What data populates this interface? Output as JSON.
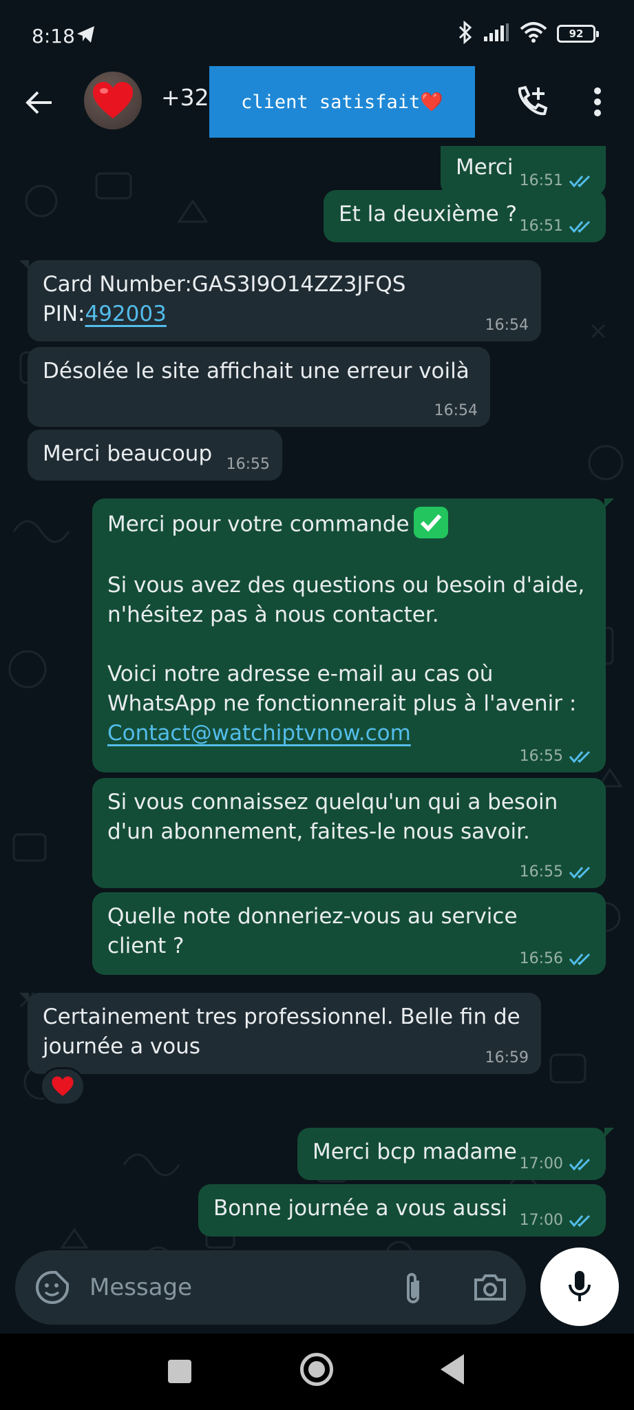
{
  "status_bar": {
    "time": "8:18",
    "battery": "92"
  },
  "header": {
    "contact_name": "+32",
    "overlay_label": "client satisfait❤️",
    "avatar_emoji": "❤️"
  },
  "messages": [
    {
      "direction": "out",
      "text": "Merci",
      "time": "16:51",
      "status": "read"
    },
    {
      "direction": "out",
      "text": "Et la deuxième ?",
      "time": "16:51",
      "status": "read"
    },
    {
      "direction": "in",
      "text_line1": "Card Number:GAS3I9O14ZZ3JFQS",
      "pin_label": "PIN:",
      "pin_value": "492003",
      "time": "16:54"
    },
    {
      "direction": "in",
      "text": "Désolée le site affichait une erreur voilà",
      "time": "16:54"
    },
    {
      "direction": "in",
      "text": "Merci beaucoup",
      "time": "16:55"
    },
    {
      "direction": "out",
      "text_line1": "Merci pour votre commande",
      "paragraph2": "Si vous avez des questions ou besoin d'aide,\nn'hésitez pas à nous contacter.",
      "paragraph3": "Voici notre adresse e-mail au cas où\nWhatsApp ne fonctionnerait plus à l'avenir :",
      "email": "Contact@watchiptvnow.com",
      "time": "16:55",
      "status": "read"
    },
    {
      "direction": "out",
      "text": "Si vous connaissez quelqu'un qui a besoin\nd'un abonnement, faites-le nous savoir.",
      "time": "16:55",
      "status": "read"
    },
    {
      "direction": "out",
      "text": "Quelle note donneriez-vous au service\nclient ?",
      "time": "16:56",
      "status": "read"
    },
    {
      "direction": "in",
      "text": "Certainement tres professionnel. Belle fin de\njournée a vous",
      "time": "16:59",
      "reaction": "❤️"
    },
    {
      "direction": "out",
      "text": "Merci bcp madame",
      "time": "17:00",
      "status": "read"
    },
    {
      "direction": "out",
      "text": "Bonne journée a vous aussi",
      "time": "17:00",
      "status": "read"
    }
  ],
  "input": {
    "placeholder": "Message"
  },
  "colors": {
    "background": "#0b141a",
    "incoming_bubble": "#202c33",
    "outgoing_bubble": "#144d37",
    "read_tick": "#53bdeb",
    "overlay": "#1e88d6"
  },
  "icons": [
    "telegram-icon",
    "bluetooth-icon",
    "signal-icon",
    "wifi-icon",
    "battery-icon",
    "back-arrow-icon",
    "add-call-icon",
    "more-vert-icon",
    "sticker-icon",
    "attach-icon",
    "camera-icon",
    "mic-icon"
  ]
}
